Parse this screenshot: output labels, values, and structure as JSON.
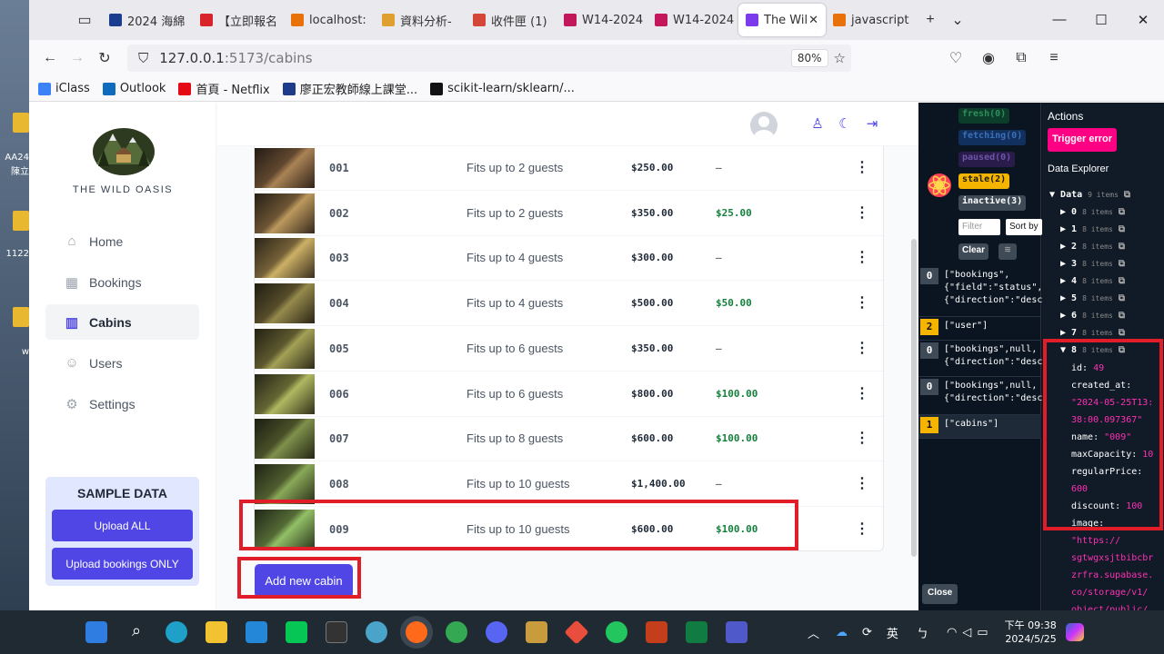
{
  "browser": {
    "tabs": [
      {
        "label": "2024 海綿",
        "color": "#1a3d8f"
      },
      {
        "label": "【立即報名",
        "color": "#d8232a"
      },
      {
        "label": "localhost:",
        "color": "#e8710a"
      },
      {
        "label": "資料分析-",
        "color": "#e0a030"
      },
      {
        "label": "收件匣 (1)",
        "color": "#d44638"
      },
      {
        "label": "W14-2024",
        "color": "#c2185b"
      },
      {
        "label": "W14-2024",
        "color": "#c2185b"
      },
      {
        "label": "The Wil",
        "color": "#7c3aed"
      },
      {
        "label": "javascript",
        "color": "#e8710a"
      }
    ],
    "url_host": "127.0.0.1",
    "url_rest": ":5173/cabins",
    "zoom": "80%",
    "bookmarks": [
      {
        "label": "iClass",
        "color": "#3b82f6"
      },
      {
        "label": "Outlook",
        "color": "#0f6cbd"
      },
      {
        "label": "首頁 - Netflix",
        "color": "#e50914"
      },
      {
        "label": "廖正宏教師線上課堂...",
        "color": "#1e3a8a"
      },
      {
        "label": "scikit-learn/sklearn/...",
        "color": "#111111"
      }
    ]
  },
  "desktop": {
    "labels": [
      "AA24",
      "陳立",
      "1122",
      "w"
    ]
  },
  "app": {
    "brand": "THE WILD OASIS",
    "nav": [
      {
        "label": "Home",
        "icon": "home-icon",
        "glyph": "⌂"
      },
      {
        "label": "Bookings",
        "icon": "calendar-icon",
        "glyph": "▦"
      },
      {
        "label": "Cabins",
        "icon": "building-icon",
        "glyph": "▥"
      },
      {
        "label": "Users",
        "icon": "users-icon",
        "glyph": "☺"
      },
      {
        "label": "Settings",
        "icon": "gear-icon",
        "glyph": "⚙"
      }
    ],
    "sample": {
      "title": "SAMPLE DATA",
      "upload_all": "Upload ALL",
      "upload_bookings": "Upload bookings ONLY"
    },
    "add_cabin": "Add new cabin",
    "cabins": [
      {
        "name": "001",
        "capacity": "Fits up to 2 guests",
        "price": "$250.00",
        "discount": "—"
      },
      {
        "name": "002",
        "capacity": "Fits up to 2 guests",
        "price": "$350.00",
        "discount": "$25.00"
      },
      {
        "name": "003",
        "capacity": "Fits up to 4 guests",
        "price": "$300.00",
        "discount": "—"
      },
      {
        "name": "004",
        "capacity": "Fits up to 4 guests",
        "price": "$500.00",
        "discount": "$50.00"
      },
      {
        "name": "005",
        "capacity": "Fits up to 6 guests",
        "price": "$350.00",
        "discount": "—"
      },
      {
        "name": "006",
        "capacity": "Fits up to 6 guests",
        "price": "$800.00",
        "discount": "$100.00"
      },
      {
        "name": "007",
        "capacity": "Fits up to 8 guests",
        "price": "$600.00",
        "discount": "$100.00"
      },
      {
        "name": "008",
        "capacity": "Fits up to 10 guests",
        "price": "$1,400.00",
        "discount": "—"
      },
      {
        "name": "009",
        "capacity": "Fits up to 10 guests",
        "price": "$600.00",
        "discount": "$100.00"
      }
    ]
  },
  "devtools": {
    "filters": [
      {
        "label": "fresh(0)",
        "bg": "#0b3d2a",
        "fg": "#2f8f5b"
      },
      {
        "label": "fetching(0)",
        "bg": "#12305e",
        "fg": "#3a6fb8"
      },
      {
        "label": "paused(0)",
        "bg": "#2a1c4a",
        "fg": "#6a55a8"
      },
      {
        "label": "stale(2)",
        "bg": "#f5b400",
        "fg": "#1a1a1a"
      },
      {
        "label": "inactive(3)",
        "bg": "#3f4a57",
        "fg": "#ffffff"
      }
    ],
    "filter_placeholder": "Filter",
    "sort_label": "Sort by",
    "clear": "Clear",
    "close": "Close",
    "queries": [
      {
        "count": "0",
        "key": "[\"bookings\",\n{\"field\":\"status\",\"va\n{\"direction\":\"desc\",\"",
        "bg": "#3f4a57"
      },
      {
        "count": "2",
        "key": "[\"user\"]",
        "bg": "#f5b400"
      },
      {
        "count": "0",
        "key": "[\"bookings\",null,\n{\"direction\":\"desc\",\"",
        "bg": "#3f4a57"
      },
      {
        "count": "0",
        "key": "[\"bookings\",null,\n{\"direction\":\"desc\",\"",
        "bg": "#3f4a57"
      },
      {
        "count": "1",
        "key": "[\"cabins\"]",
        "bg": "#f5b400"
      }
    ],
    "actions_title": "Actions",
    "trigger_error": "Trigger error",
    "explorer_title": "Data Explorer",
    "data_root": "Data",
    "data_root_count": "9 items",
    "indices": [
      "0",
      "1",
      "2",
      "3",
      "4",
      "5",
      "6",
      "7"
    ],
    "index_count": "8 items",
    "expanded_index": "8",
    "fields": [
      {
        "k": "id:",
        "v": "49"
      },
      {
        "k": "created_at:",
        "v": ""
      },
      {
        "k": "",
        "v": "\"2024-05-25T13:"
      },
      {
        "k": "",
        "v": "38:00.097367\""
      },
      {
        "k": "name:",
        "v": "\"009\""
      },
      {
        "k": "maxCapacity:",
        "v": "10"
      },
      {
        "k": "regularPrice:",
        "v": ""
      },
      {
        "k": "",
        "v": "600"
      },
      {
        "k": "discount:",
        "v": "100"
      },
      {
        "k": "image:",
        "v": ""
      },
      {
        "k": "",
        "v": "\"https://"
      },
      {
        "k": "",
        "v": "sgtwgxsjtbibcbr"
      },
      {
        "k": "",
        "v": "zrfra.supabase."
      },
      {
        "k": "",
        "v": "co/storage/v1/"
      },
      {
        "k": "",
        "v": "object/public/"
      }
    ]
  },
  "taskbar": {
    "ime": "英",
    "ime2": "ㄅ",
    "time": "下午 09:38",
    "date": "2024/5/25"
  }
}
